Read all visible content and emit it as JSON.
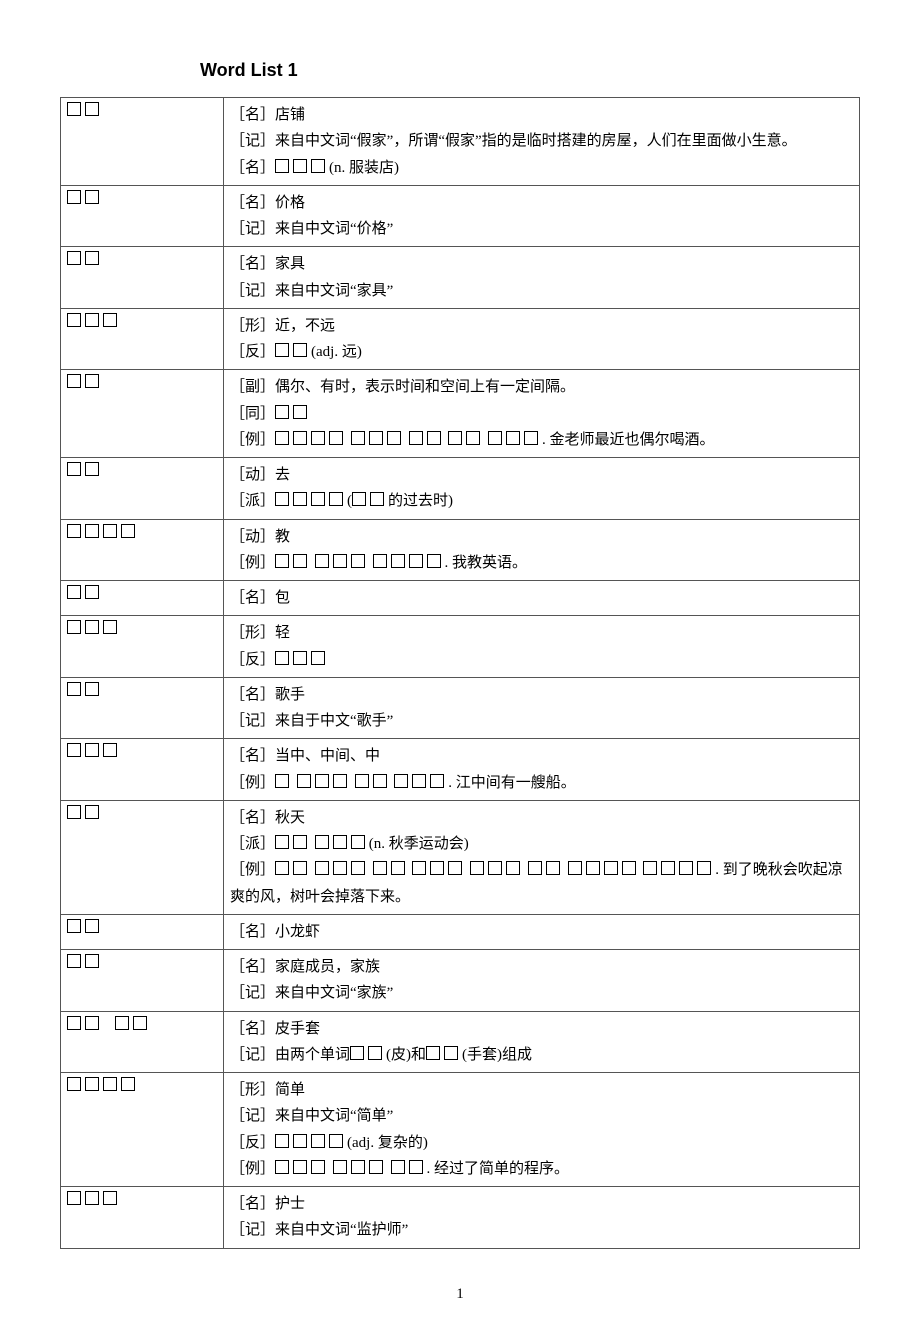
{
  "title": "Word List 1",
  "page_number": "1",
  "entries": [
    {
      "term_boxes": 2,
      "lines": [
        {
          "tag": "［名］",
          "text": "店铺"
        },
        {
          "tag": "［记］",
          "text": "来自中文词“假家”，所谓“假家”指的是临时搭建的房屋，人们在里面做小生意。"
        },
        {
          "tag": "［名］",
          "boxes": [
            3
          ],
          "post": "(n. 服装店)"
        }
      ]
    },
    {
      "term_boxes": 2,
      "lines": [
        {
          "tag": "［名］",
          "text": "价格"
        },
        {
          "tag": "［记］",
          "text": "来自中文词“价格”"
        }
      ]
    },
    {
      "term_boxes": 2,
      "lines": [
        {
          "tag": "［名］",
          "text": "家具"
        },
        {
          "tag": "［记］",
          "text": "来自中文词“家具”"
        }
      ]
    },
    {
      "term_boxes": 3,
      "lines": [
        {
          "tag": "［形］",
          "text": "近，不远"
        },
        {
          "tag": "［反］",
          "boxes": [
            2
          ],
          "post": "(adj. 远)"
        }
      ]
    },
    {
      "term_boxes": 2,
      "lines": [
        {
          "tag": "［副］",
          "text": "偶尔、有时，表示时间和空间上有一定间隔。"
        },
        {
          "tag": "［同］",
          "boxes": [
            2
          ]
        },
        {
          "tag": "［例］",
          "boxes": [
            4,
            3,
            2,
            2,
            3
          ],
          "post": ".  金老师最近也偶尔喝酒。"
        }
      ]
    },
    {
      "term_boxes": 2,
      "lines": [
        {
          "tag": "［动］",
          "text": "去"
        },
        {
          "tag": "［派］",
          "boxes": [
            4
          ],
          "mid": "(",
          "boxes2": [
            2
          ],
          "post": "的过去时)"
        }
      ]
    },
    {
      "term_boxes": 4,
      "lines": [
        {
          "tag": "［动］",
          "text": "教"
        },
        {
          "tag": "［例］",
          "boxes": [
            2,
            3,
            4
          ],
          "post": ".  我教英语。"
        }
      ]
    },
    {
      "term_boxes": 2,
      "lines": [
        {
          "tag": "［名］",
          "text": "包"
        }
      ]
    },
    {
      "term_boxes": 3,
      "lines": [
        {
          "tag": "［形］",
          "text": "轻"
        },
        {
          "tag": "［反］",
          "boxes": [
            3
          ]
        }
      ]
    },
    {
      "term_boxes": 2,
      "lines": [
        {
          "tag": "［名］",
          "text": "歌手"
        },
        {
          "tag": "［记］",
          "text": "来自于中文“歌手”"
        }
      ]
    },
    {
      "term_boxes": 3,
      "lines": [
        {
          "tag": "［名］",
          "text": "当中、中间、中"
        },
        {
          "tag": "［例］",
          "boxes": [
            1,
            3,
            2,
            3
          ],
          "post": ".  江中间有一艘船。"
        }
      ]
    },
    {
      "term_boxes": 2,
      "lines": [
        {
          "tag": "［名］",
          "text": "秋天"
        },
        {
          "tag": "［派］",
          "boxes": [
            2,
            3
          ],
          "post": "(n. 秋季运动会)"
        },
        {
          "tag": "［例］",
          "boxes": [
            2,
            3,
            2,
            3,
            3,
            2,
            4,
            4
          ],
          "post": ".  到了晚秋会吹起凉爽的风，树叶会掉落下来。"
        }
      ]
    },
    {
      "term_boxes": 2,
      "lines": [
        {
          "tag": "［名］",
          "text": "小龙虾"
        }
      ]
    },
    {
      "term_boxes": 2,
      "lines": [
        {
          "tag": "［名］",
          "text": "家庭成员，家族"
        },
        {
          "tag": "［记］",
          "text": "来自中文词“家族”"
        }
      ]
    },
    {
      "term_box_groups": [
        2,
        2
      ],
      "lines": [
        {
          "tag": "［名］",
          "text": "皮手套"
        },
        {
          "tag": "［记］",
          "pre": "由两个单词",
          "boxes": [
            2
          ],
          "mid": "(皮)和",
          "boxes2": [
            2
          ],
          "post": "(手套)组成"
        }
      ]
    },
    {
      "term_boxes": 4,
      "lines": [
        {
          "tag": "［形］",
          "text": "简单"
        },
        {
          "tag": "［记］",
          "text": "来自中文词“简单”"
        },
        {
          "tag": "［反］",
          "boxes": [
            4
          ],
          "post": "(adj. 复杂的)"
        },
        {
          "tag": "［例］",
          "boxes": [
            3,
            3,
            2
          ],
          "post": ".  经过了简单的程序。"
        }
      ]
    },
    {
      "term_boxes": 3,
      "lines": [
        {
          "tag": "［名］",
          "text": "护士"
        },
        {
          "tag": "［记］",
          "text": "来自中文词“监护师”"
        }
      ]
    }
  ]
}
